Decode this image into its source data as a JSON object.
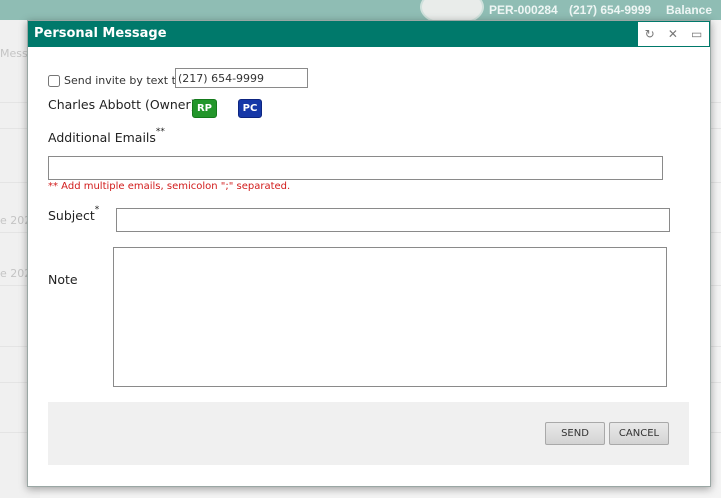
{
  "background": {
    "header": {
      "record_id": "PER-000284",
      "phone": "(217) 654-9999",
      "balance_label": "Balance"
    },
    "sidebar_texts": [
      "Mess",
      "e 202",
      "e 202"
    ]
  },
  "modal": {
    "title": "Personal Message",
    "controls": {
      "refresh_icon": "refresh-icon",
      "close_icon": "close-icon",
      "maximize_icon": "maximize-icon"
    },
    "sms_invite": {
      "label": "Send invite by text to:",
      "checked": false,
      "phone_value": "(217) 654-9999"
    },
    "recipient": {
      "name": "Charles Abbott (Owner)",
      "badges": {
        "rp": "RP",
        "pc": "PC"
      }
    },
    "additional_emails": {
      "label": "Additional Emails",
      "required_mark": "**",
      "value": "",
      "hint": "** Add multiple emails, semicolon \";\" separated."
    },
    "subject": {
      "label": "Subject",
      "required_mark": "*",
      "value": ""
    },
    "note": {
      "label": "Note",
      "value": ""
    },
    "buttons": {
      "send": "SEND",
      "cancel": "CANCEL"
    }
  },
  "colors": {
    "titlebar": "#00796b",
    "badge_rp": "#23962b",
    "badge_pc": "#1638a8",
    "hint": "#d11b1b"
  }
}
